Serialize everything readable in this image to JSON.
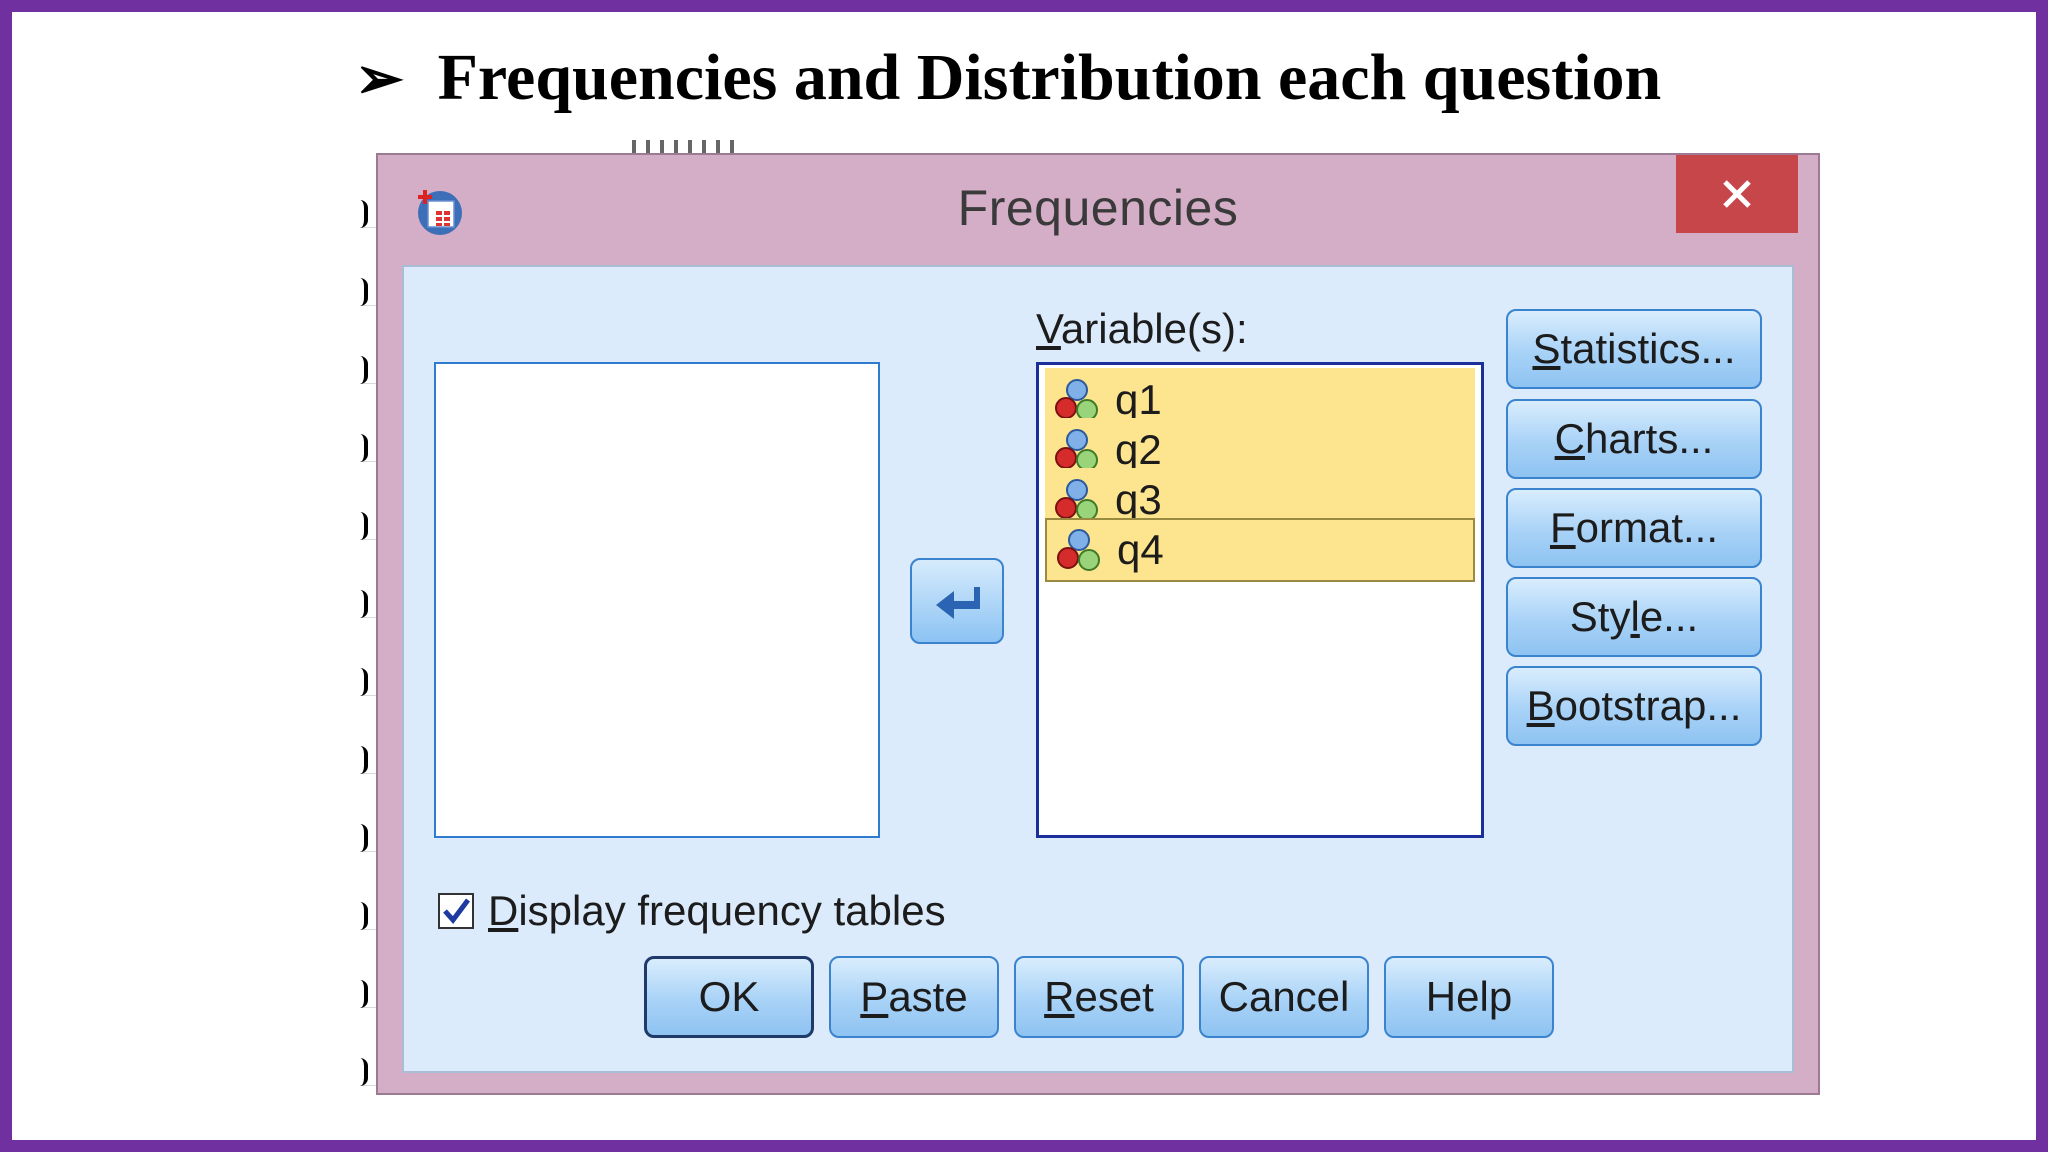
{
  "slide": {
    "bullet": "➢",
    "title": "Frequencies and Distribution each question"
  },
  "dialog": {
    "title": "Frequencies",
    "close_glyph": "✕",
    "variables_label_mnemonic": "V",
    "variables_label_rest": "ariable(s):",
    "variables": [
      {
        "name": "q1",
        "icon": "nominal-variable-icon"
      },
      {
        "name": "q2",
        "icon": "nominal-variable-icon"
      },
      {
        "name": "q3",
        "icon": "nominal-variable-icon"
      },
      {
        "name": "q4",
        "icon": "nominal-variable-icon"
      }
    ],
    "side_buttons": [
      {
        "mn": "S",
        "rest": "tatistics..."
      },
      {
        "mn": "C",
        "rest": "harts..."
      },
      {
        "mn": "F",
        "rest": "ormat..."
      },
      {
        "pre": "Sty",
        "mn": "l",
        "rest": "e..."
      },
      {
        "mn": "B",
        "rest": "ootstrap..."
      }
    ],
    "checkbox": {
      "mn": "D",
      "rest": "isplay frequency tables",
      "checked": true
    },
    "bottom_buttons": [
      {
        "label": "OK"
      },
      {
        "mn": "P",
        "rest": "aste"
      },
      {
        "mn": "R",
        "rest": "eset"
      },
      {
        "label": "Cancel"
      },
      {
        "label": "Help"
      }
    ]
  }
}
